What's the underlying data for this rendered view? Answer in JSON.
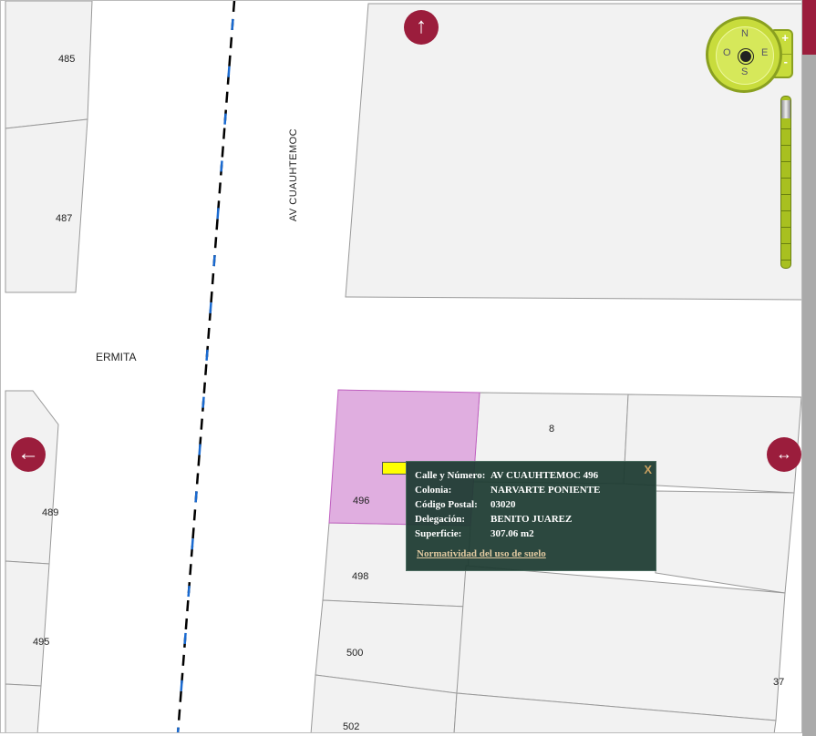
{
  "map": {
    "street_labels": {
      "av_cuauhtemoc": "AV CUAUHTEMOC",
      "ermita": "ERMITA"
    },
    "parcel_numbers": [
      "485",
      "487",
      "489",
      "495",
      "496",
      "498",
      "500",
      "502",
      "8",
      "37"
    ]
  },
  "navigation": {
    "up_icon": "↑",
    "left_icon": "←",
    "right_icon": "↔"
  },
  "compass": {
    "north": "N",
    "south": "S",
    "east": "E",
    "west": "O",
    "zoom_in": "+",
    "zoom_out": "-"
  },
  "zoom_slider": {
    "level_fraction": 0.0
  },
  "popup": {
    "close_label": "X",
    "rows": [
      {
        "label": "Calle y Número:",
        "value": "AV CUAUHTEMOC 496"
      },
      {
        "label": "Colonia:",
        "value": "NARVARTE PONIENTE"
      },
      {
        "label": "Código Postal:",
        "value": "03020"
      },
      {
        "label": "Delegación:",
        "value": "BENITO JUAREZ"
      },
      {
        "label": "Superficie:",
        "value": "307.06 m2"
      }
    ],
    "link": "Normatividad del uso de suelo"
  },
  "colors": {
    "selected_parcel": "#e0aee0",
    "nav_button": "#9b1d3c",
    "control": "#c8dc3c",
    "popup_bg": "#1c3a30"
  }
}
